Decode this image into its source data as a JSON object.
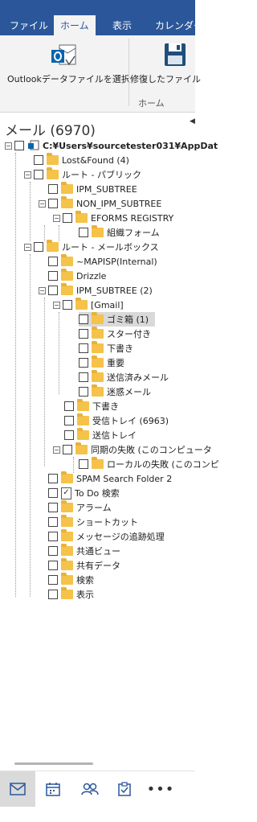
{
  "ribbon": {
    "tabs": [
      "ファイル",
      "ホーム",
      "表示",
      "カレンダー"
    ],
    "active_tab": "ホーム",
    "buttons": [
      {
        "label": "Outlookデータファイルを選択",
        "icon": "outlook-icon"
      },
      {
        "label": "修復したファイル",
        "icon": "save-icon"
      }
    ],
    "group_label": "ホーム"
  },
  "pane": {
    "title": "メール (6970)"
  },
  "tree": {
    "root": "C:¥Users¥sourcetester031¥AppDat",
    "items": [
      "Lost&Found (4)",
      "ルート - パブリック",
      "IPM_SUBTREE",
      "NON_IPM_SUBTREE",
      "EFORMS REGISTRY",
      "組織フォーム",
      "ルート - メールボックス",
      "~MAPISP(Internal)",
      "Drizzle",
      "IPM_SUBTREE (2)",
      "[Gmail]",
      "ゴミ箱 (1)",
      "スター付き",
      "下書き",
      "重要",
      "送信済みメール",
      "迷惑メール",
      "下書き",
      "受信トレイ (6963)",
      "送信トレイ",
      "同期の失敗 (このコンピュータ",
      "ローカルの失敗 (このコンピ",
      "SPAM Search Folder 2",
      "To Do 検索",
      "アラーム",
      "ショートカット",
      "メッセージの追跡処理",
      "共通ビュー",
      "共有データ",
      "検索",
      "表示"
    ]
  },
  "nav": {
    "icons": [
      "mail-icon",
      "calendar-icon",
      "people-icon",
      "tasks-icon",
      "more-icon"
    ],
    "more_label": "•••"
  },
  "colors": {
    "ribbon_blue": "#2b579a",
    "folder_yellow": "#f5c24a",
    "outlook_blue": "#0a64ad"
  }
}
